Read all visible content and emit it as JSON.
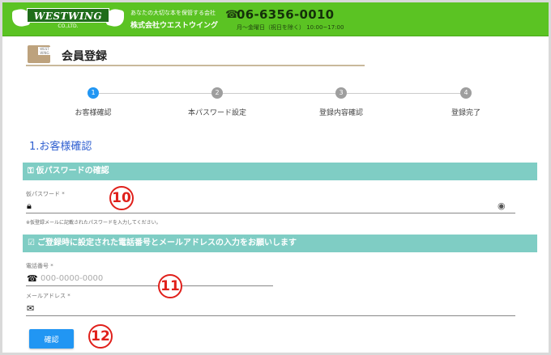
{
  "header": {
    "logo_text": "WESTWING",
    "logo_sub": "CO.,LTD.",
    "tagline": "あなたの大切な本を保管する会社",
    "company": "株式会社ウエストウイング",
    "phone": "06-6356-0010",
    "hours": "月～金曜日（祝日を除く） 10:00~17:00",
    "brand_color": "#5bc323"
  },
  "page": {
    "title": "会員登録",
    "title_icon_tag": "WEST WING"
  },
  "stepper": {
    "steps": [
      {
        "number": "1",
        "label": "お客様確認",
        "active": true
      },
      {
        "number": "2",
        "label": "本パスワード設定",
        "active": false
      },
      {
        "number": "3",
        "label": "登録内容確認",
        "active": false
      },
      {
        "number": "4",
        "label": "登録完了",
        "active": false
      }
    ],
    "active_color": "#2196f3"
  },
  "section_heading": "1.お客様確認",
  "password_section": {
    "bar_title": "仮パスワードの確認",
    "field_label": "仮パスワード *",
    "value": "",
    "helper": "※仮登録メールに記載されたパスワードを入力してください。"
  },
  "contact_section": {
    "bar_title": "ご登録時に設定された電話番号とメールアドレスの入力をお願いします",
    "phone_label": "電話番号 *",
    "phone_placeholder": "000-0000-0000",
    "email_label": "メールアドレス *",
    "email_value": ""
  },
  "markers": {
    "m10": "10",
    "m11": "11",
    "m12": "12"
  },
  "confirm_button": "確認",
  "icons": {
    "phone": "phone-icon",
    "lock": "lock-icon",
    "eye": "eye-icon",
    "mail": "mail-icon",
    "key": "key-icon",
    "checkbox": "checkbox-icon"
  }
}
